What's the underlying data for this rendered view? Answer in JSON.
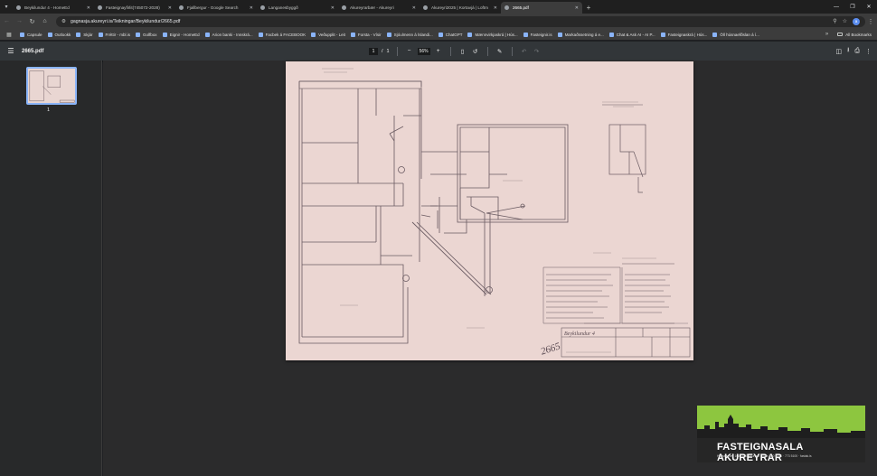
{
  "browser": {
    "tabs": [
      {
        "title": "Beykilundur 4 - HomeEd",
        "active": false
      },
      {
        "title": "Fasteignayfirlit(745072-2028) ",
        "active": false
      },
      {
        "title": "Fjallbergur - Google Search",
        "active": false
      },
      {
        "title": "Langanesbyggð",
        "active": false
      },
      {
        "title": "Akureyrarbær - Akureyri",
        "active": false
      },
      {
        "title": "Akureyri2025 | Kortavjá | Loftm",
        "active": false
      },
      {
        "title": "2665.pdf",
        "active": true
      }
    ],
    "url": "gagnasja.akureyri.is/Teikningar/Beykilundur/2665.pdf",
    "profile_initial": "a",
    "bookmarks": [
      "Capsule",
      "Outlookk",
      "Skjár",
      "Fréttir - mbl.is",
      "Golfbox",
      "Eignir - HomeEd",
      "Arion banki - Innskrá...",
      "Facbek á FACEBOOK",
      "Veðupplit - Leit",
      "Forsta - Vísir",
      "Sjóulmenn á Íslandi...",
      "ChatGPT",
      "Mænnvirkjaskrá | Hús...",
      "Fasteignir.is",
      "Markaðssetning á e...",
      "Chat & Ask AI - AI P...",
      "Fasteignaskrá | Hús...",
      "Öll húsnaefðslan á í..."
    ],
    "all_bookmarks_label": "All Bookmarks"
  },
  "pdf": {
    "filename": "2665.pdf",
    "current_page": "1",
    "page_separator": "/",
    "total_pages": "1",
    "zoom": "56%",
    "thumbnail_label": "1"
  },
  "drawing": {
    "title_block_name": "Beykilundur 4",
    "stamp_number": "2665"
  },
  "ad": {
    "company": "FASTEIGNASALA AKUREYRAR",
    "contact_line": "Hafnarstræti 108 · 600 Akureyri · Sími 460 5151 · 773 5100 · fastak.is"
  }
}
